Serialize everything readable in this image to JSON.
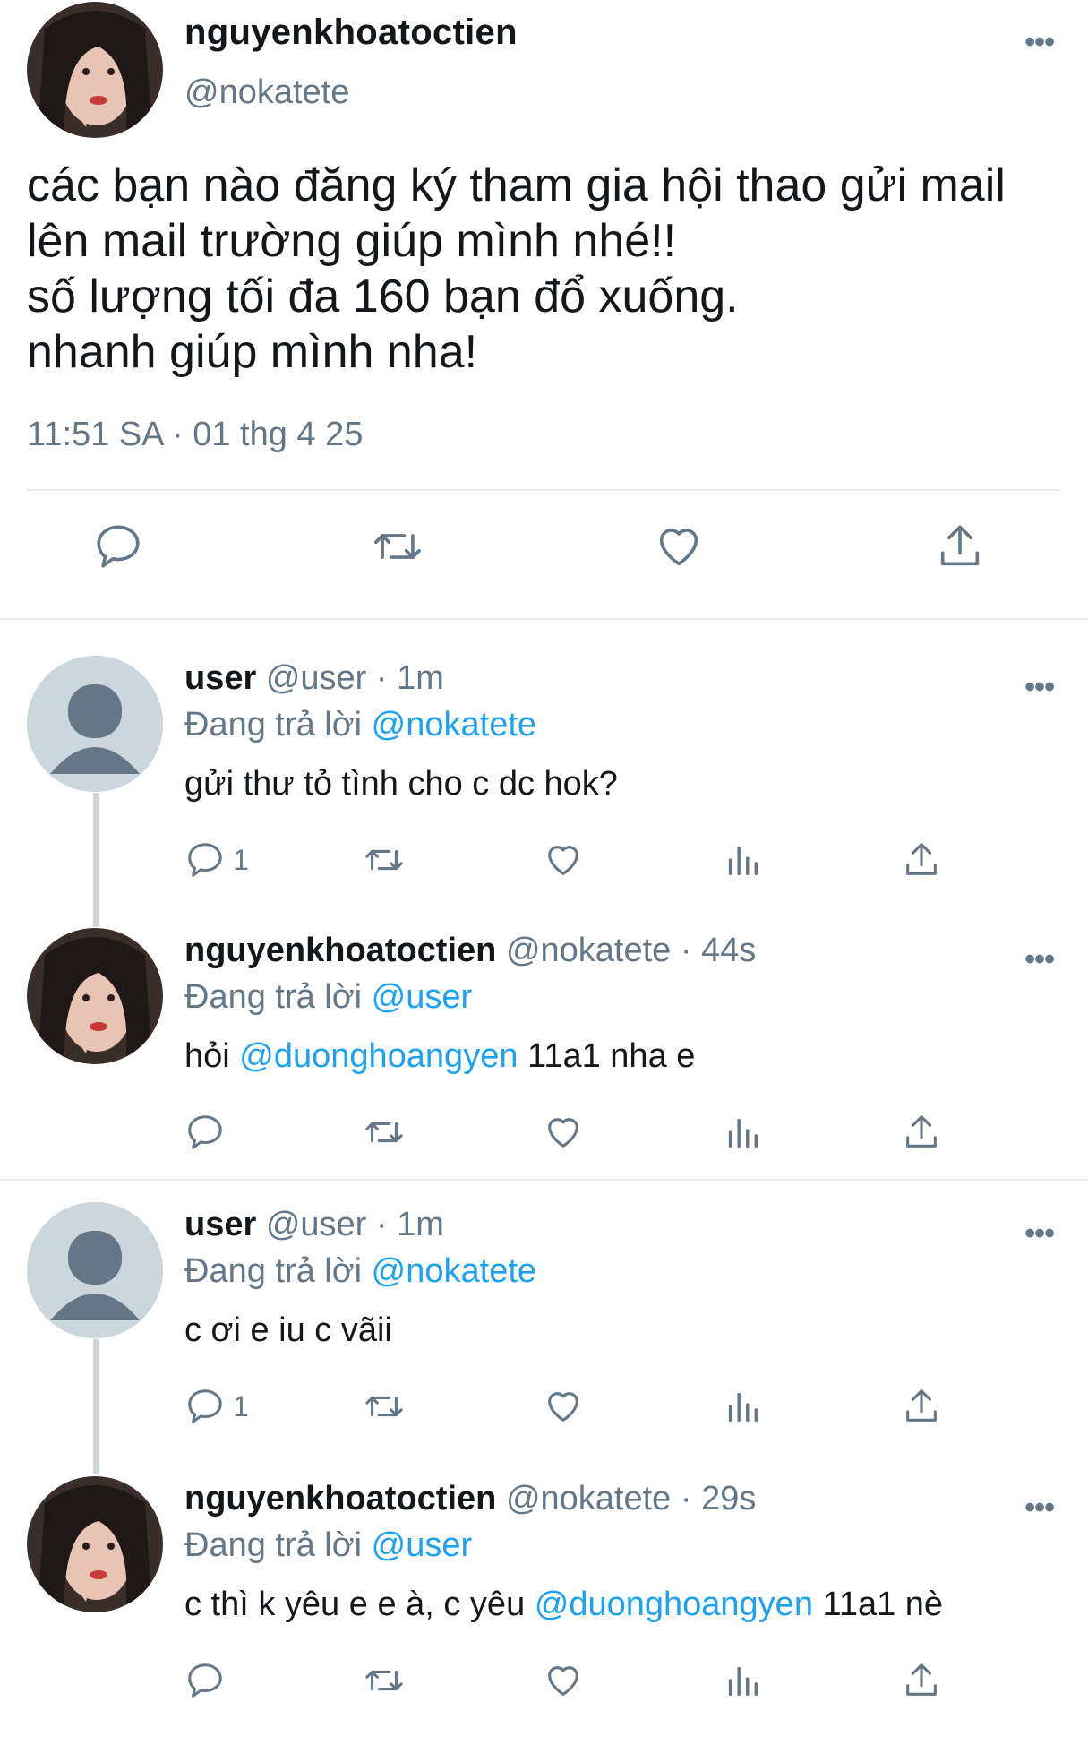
{
  "main_tweet": {
    "author_name": "nguyenkhoatoctien",
    "author_handle": "@nokatete",
    "more_label": "•••",
    "text": "các bạn nào đăng ký tham gia hội thao gửi mail\nlên mail trường giúp mình nhé!!\nsố lượng tối đa 160 bạn đổ xuống.\nnhanh giúp mình nha!",
    "timestamp": "11:51 SA · 01 thg 4 25",
    "actions": [
      "reply-icon",
      "retweet-icon",
      "like-icon",
      "share-icon"
    ]
  },
  "replies": [
    {
      "name": "user",
      "handle": "@user",
      "time": " · 1m",
      "replying_prefix": "Đang trả lời ",
      "replying_to": "@nokatete",
      "body_parts": [
        "gửi thư tỏ tình cho c dc hok?"
      ],
      "reply_count": "1",
      "avatar": "default-avatar"
    },
    {
      "name": "nguyenkhoatoctien",
      "handle": "@nokatete",
      "time": " · 44s",
      "replying_prefix": "Đang trả lời ",
      "replying_to": "@user",
      "body_parts": [
        "hỏi ",
        "@duonghoangyen",
        " 11a1 nha e"
      ],
      "reply_count": "",
      "avatar": "profile-photo"
    },
    {
      "name": "user",
      "handle": "@user",
      "time": " · 1m",
      "replying_prefix": "Đang trả lời ",
      "replying_to": "@nokatete",
      "body_parts": [
        "c ơi e iu c vãii"
      ],
      "reply_count": "1",
      "avatar": "default-avatar"
    },
    {
      "name": "nguyenkhoatoctien",
      "handle": "@nokatete",
      "time": " · 29s",
      "replying_prefix": "Đang trả lời ",
      "replying_to": "@user",
      "body_parts": [
        "c thì k yêu e e à, c yêu ",
        "@duonghoangyen",
        " 11a1 nè"
      ],
      "reply_count": "",
      "avatar": "profile-photo"
    }
  ],
  "colors": {
    "link": "#1da1f2",
    "secondary_text": "#657786",
    "divider": "#e6ecf0",
    "thread_line": "#ccd6dd"
  }
}
